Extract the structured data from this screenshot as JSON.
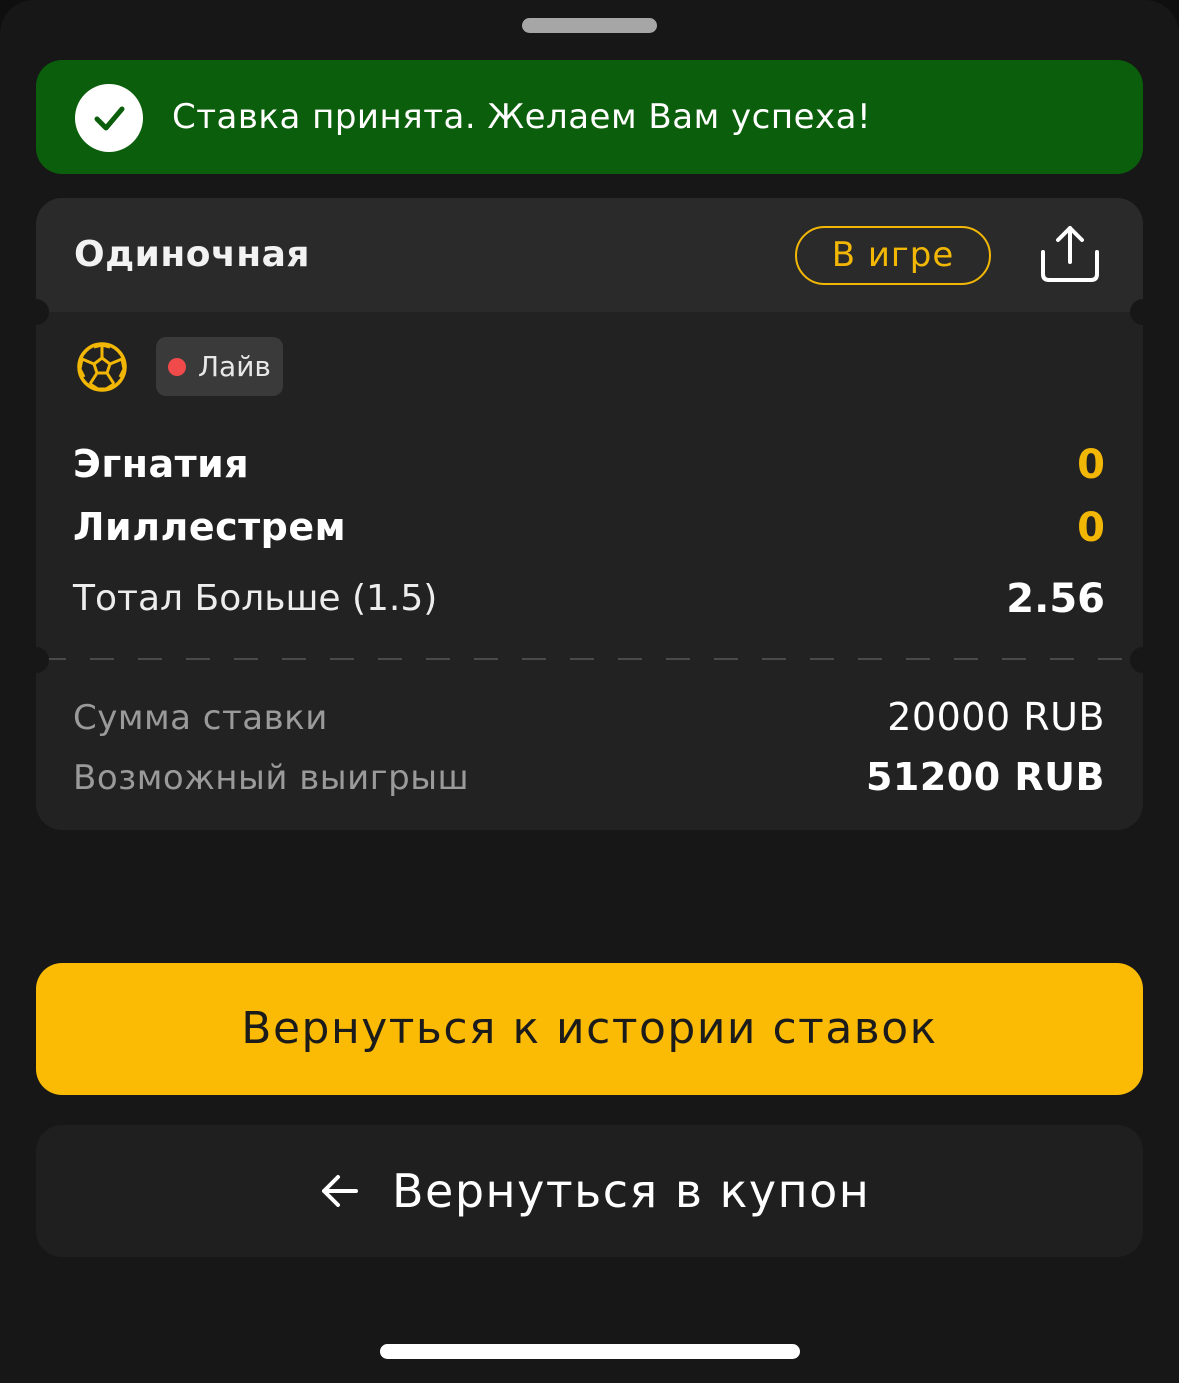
{
  "toast": {
    "message": "Ставка принята. Желаем Вам успеха!",
    "icon": "check-icon",
    "color": "#0b5e0b"
  },
  "ticket": {
    "bet_type": "Одиночная",
    "status": "В игре",
    "share_icon": "share-icon",
    "sport_icon": "soccer-ball-icon",
    "live_label": "Лайв",
    "teams": [
      {
        "name": "Эгнатия",
        "score": "0"
      },
      {
        "name": "Лиллестрем",
        "score": "0"
      }
    ],
    "market": "Тотал Больше (1.5)",
    "odds": "2.56",
    "stake_label": "Сумма ставки",
    "stake_value": "20000 RUB",
    "payout_label": "Возможный выигрыш",
    "payout_value": "51200 RUB"
  },
  "actions": {
    "history_label": "Вернуться к истории ставок",
    "coupon_label": "Вернуться в купон",
    "coupon_icon": "arrow-left-icon"
  },
  "colors": {
    "accent": "#fbbb05",
    "status": "#f2b705",
    "live_dot": "#f04a4a",
    "background": "#171717"
  }
}
